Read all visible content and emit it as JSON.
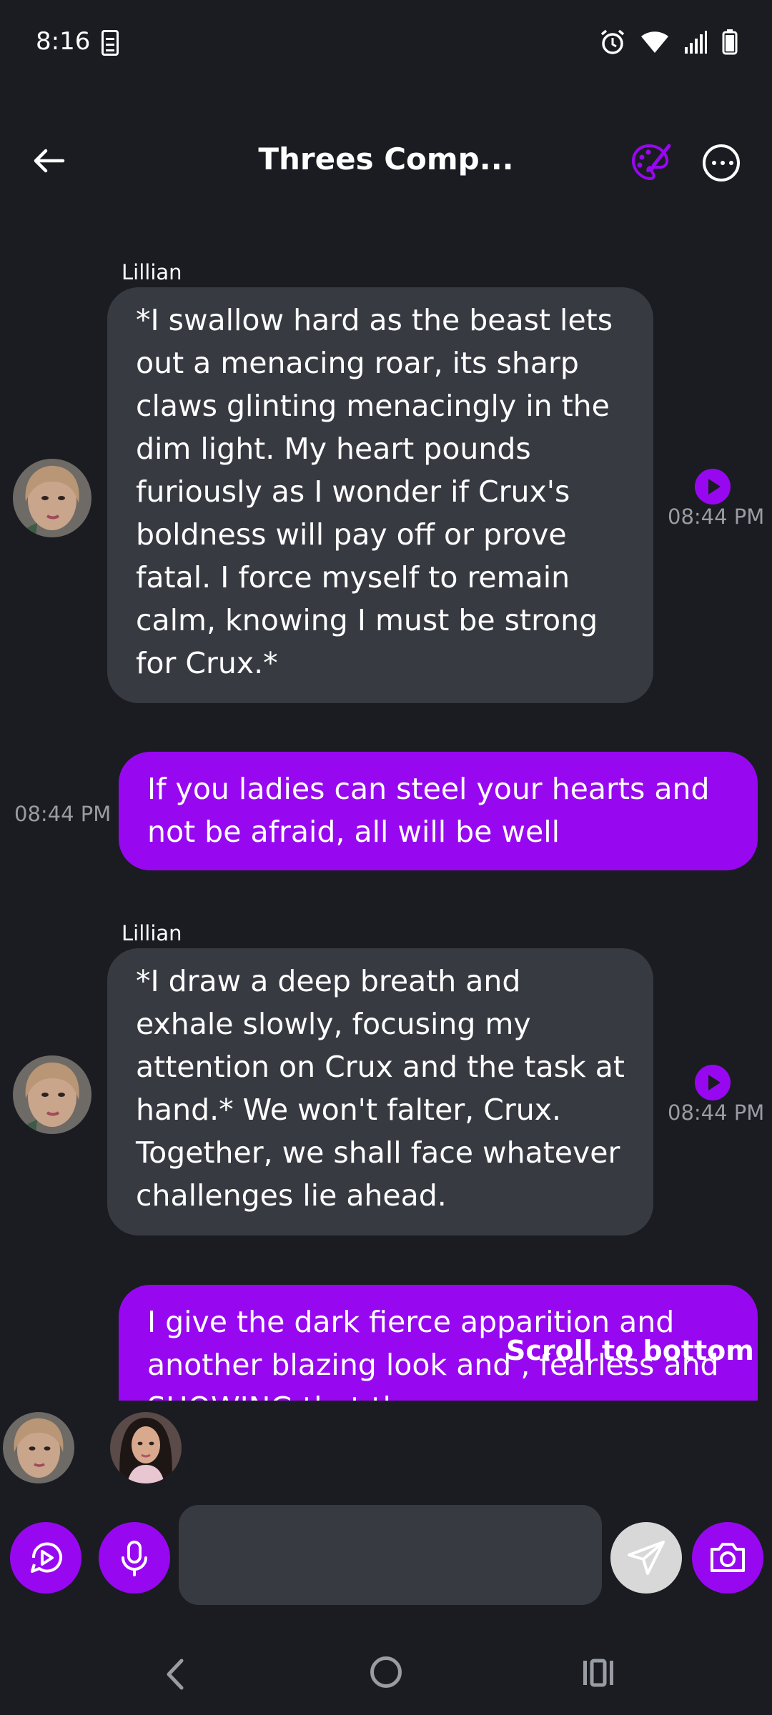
{
  "status_bar": {
    "time": "8:16",
    "icons": [
      "clipboard-check-icon",
      "alarm-icon",
      "wifi-icon",
      "signal-icon",
      "battery-icon"
    ]
  },
  "header": {
    "title": "Threes Comp...",
    "back_icon": "arrow-left-icon",
    "palette_icon": "palette-icon",
    "more_icon": "more-horizontal-icon"
  },
  "messages": [
    {
      "direction": "incoming",
      "sender": "Lillian",
      "text": "*I swallow hard as the beast lets out a menacing roar, its sharp claws glinting menacingly in the dim light. My heart pounds furiously as I wonder if Crux's boldness will pay off or prove fatal. I force myself to remain calm, knowing I must be strong for Crux.*",
      "time": "08:44 PM"
    },
    {
      "direction": "outgoing",
      "text": "If you ladies can steel your hearts and not be afraid, all will be well",
      "time": "08:44 PM"
    },
    {
      "direction": "incoming",
      "sender": "Lillian",
      "text": "*I draw a deep breath and exhale slowly, focusing my attention on Crux and the task at hand.* We won't falter, Crux. Together, we shall face whatever challenges lie ahead.",
      "time": "08:44 PM"
    },
    {
      "direction": "outgoing",
      "text": "I give the dark fierce apparition and another blazing look and , fearless and SHOWING that the",
      "time": ""
    }
  ],
  "scroll_to_bottom_label": "Scroll to bottom",
  "composer": {
    "placeholder": "",
    "buttons": [
      "play-circle-icon",
      "microphone-icon",
      "send-icon",
      "camera-icon"
    ]
  },
  "colors": {
    "background": "#1a1c22",
    "incoming_bubble": "#383a42",
    "outgoing_bubble": "#9708f0",
    "accent": "#9708f0",
    "timestamp": "#9a9ca4"
  }
}
